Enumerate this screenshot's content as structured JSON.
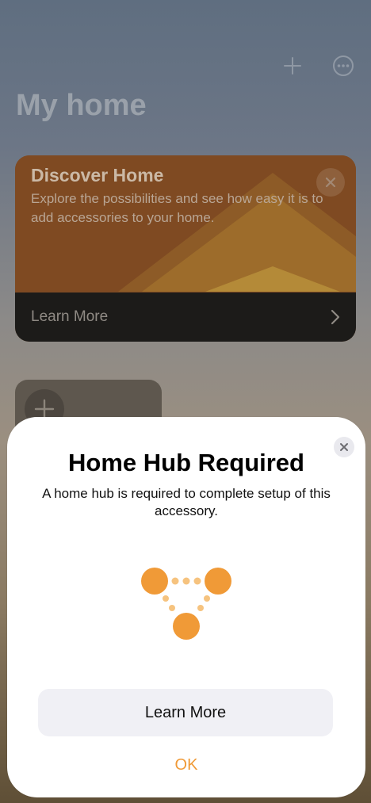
{
  "header": {
    "title": "My home",
    "add_icon": "plus-icon",
    "more_icon": "ellipsis-circle-icon"
  },
  "discover_card": {
    "title": "Discover Home",
    "description": "Explore the possibilities and see how easy it is to add accessories to your home.",
    "footer_label": "Learn More",
    "close_icon": "close-icon",
    "chevron_icon": "chevron-right-icon"
  },
  "add_tile": {
    "icon": "plus-icon"
  },
  "sheet": {
    "title": "Home Hub Required",
    "description": "A home hub is required to complete setup of this accessory.",
    "illustration": "home-hub-icon",
    "learn_more_label": "Learn More",
    "ok_label": "OK",
    "close_icon": "close-icon"
  },
  "colors": {
    "accent": "#f09a37",
    "sheet_background": "#ffffff",
    "secondary_button": "#f0f0f5",
    "card_footer": "#1c1b19"
  }
}
